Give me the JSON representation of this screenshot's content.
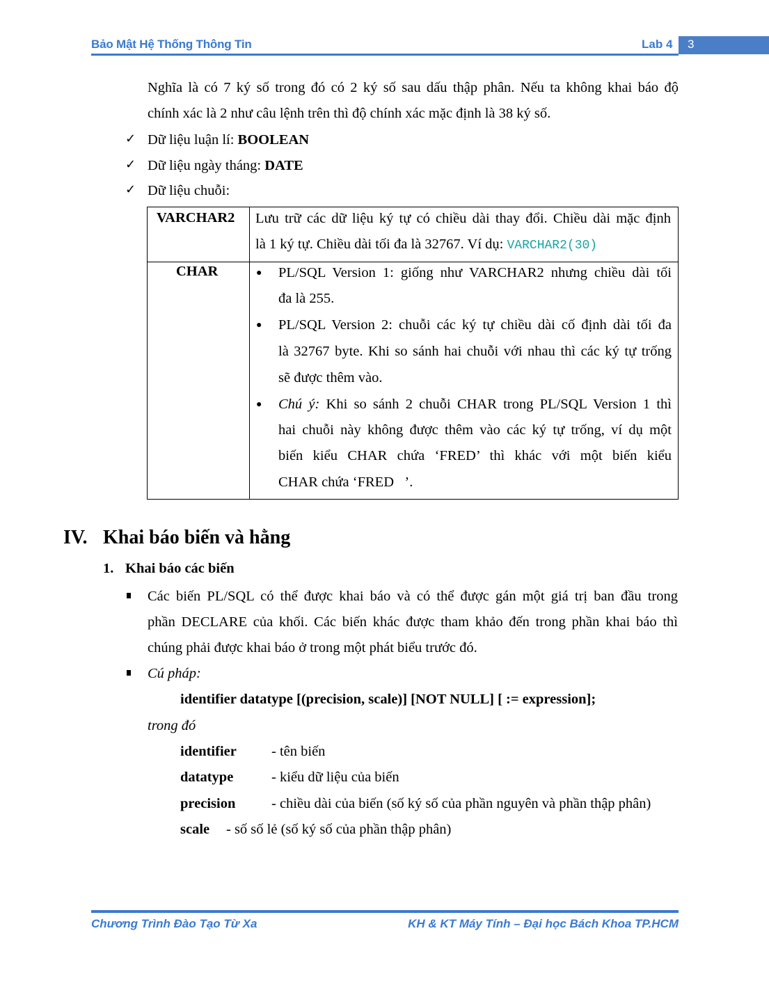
{
  "header": {
    "title": "Bảo Mật Hệ Thống Thông Tin",
    "lab": "Lab 4",
    "page_number": "3"
  },
  "intro": {
    "line1": "Nghĩa là có 7 ký số trong đó có 2 ký số sau dấu thập phân. Nếu ta không khai báo độ",
    "line2": "chính xác là 2 như câu lệnh trên thì độ chính xác mặc định là 38 ký số."
  },
  "checklist": [
    {
      "label": "Dữ liệu luận lí: ",
      "value": "BOOLEAN"
    },
    {
      "label": "Dữ liệu ngày tháng: ",
      "value": "DATE"
    },
    {
      "label": "Dữ liệu chuỗi:",
      "value": ""
    }
  ],
  "string_table": {
    "rows": [
      {
        "type": "VARCHAR2",
        "line1": "Lưu trữ các dữ liệu ký tự có chiều dài thay đổi. Chiều dài mặc định",
        "line2": "là 1 ký tự. Chiều dài tối đa là 32767. Ví dụ: ",
        "example": "VARCHAR2(30)"
      },
      {
        "type": "CHAR",
        "bullets": [
          {
            "lines": [
              "PL/SQL Version 1: giống như VARCHAR2 nhưng chiều dài tối",
              "đa là 255."
            ]
          },
          {
            "lines": [
              "PL/SQL Version 2: chuỗi các ký tự chiều dài cố định dài tối đa",
              "là 32767 byte. Khi so sánh hai chuỗi với nhau thì các ký tự trống",
              "sẽ được thêm vào."
            ]
          },
          {
            "italic_prefix": "Chú ý:",
            "lines": [
              " Khi so sánh 2 chuỗi CHAR trong PL/SQL Version 1 thì",
              "hai chuỗi này không được thêm vào các ký tự trống, ví dụ một",
              "biến kiểu CHAR chứa ‘FRED’ thì khác với một biến kiểu",
              "CHAR chứa ‘FRED   ’."
            ]
          }
        ]
      }
    ]
  },
  "section": {
    "number": "IV.",
    "title": "Khai báo biến và hằng",
    "subsection_number": "1.",
    "subsection_title": "Khai báo các biến",
    "paragraph": [
      "Các biến PL/SQL có thể được khai báo và có thể được gán một giá trị ban đầu trong",
      "phần DECLARE của khối. Các biến khác được tham khảo đến trong phần khai báo thì",
      "chúng phải được khai báo ở trong một phát biểu trước đó."
    ],
    "syntax_label": "Cú pháp:",
    "syntax": "identifier datatype [(precision, scale)] [NOT NULL] [ := expression];",
    "where_label": "trong đó",
    "definitions": [
      {
        "term": "identifier",
        "desc": "- tên biến"
      },
      {
        "term": "datatype",
        "desc": "- kiểu dữ liệu của biến"
      },
      {
        "term": "precision",
        "desc": "- chiều dài của biến (số ký số của phần nguyên và phần thập phân)"
      },
      {
        "term": "scale",
        "desc": "- số số lẻ (số ký số của phần thập phân)"
      }
    ]
  },
  "footer": {
    "left": "Chương Trình Đào Tạo Từ Xa",
    "right": "KH & KT Máy Tính – Đại học Bách Khoa TP.HCM"
  },
  "colors": {
    "accent": "#3a7ad0",
    "page_box": "#4a7fc7",
    "code": "#1aa3a3"
  }
}
